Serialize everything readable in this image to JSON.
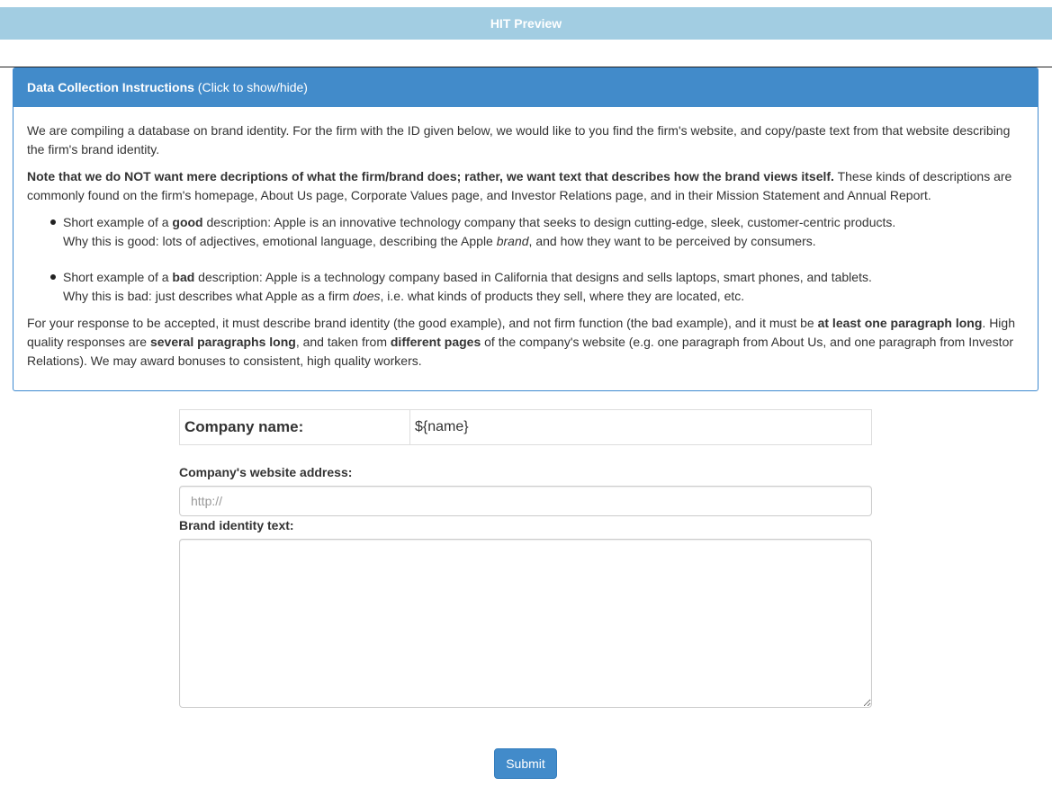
{
  "header": {
    "title": "HIT Preview"
  },
  "instructions": {
    "heading_bold": "Data Collection Instructions",
    "heading_hint": " (Click to show/hide)",
    "intro": "We are compiling a database on brand identity. For the firm with the ID given below, we would like to you find the firm's website, and copy/paste text from that website describing the firm's brand identity.",
    "note_bold": "Note that we do NOT want mere decriptions of what the firm/brand does; rather, we want text that describes how the brand views itself.",
    "note_rest": " These kinds of descriptions are commonly found on the firm's homepage, About Us page, Corporate Values page, and Investor Relations page, and in their Mission Statement and Annual Report.",
    "good_example": {
      "pre": "Short example of a ",
      "bold": "good",
      "post": " description: Apple is an innovative technology company that seeks to design cutting-edge, sleek, customer-centric products.",
      "why_pre": "Why this is good: lots of adjectives, emotional language, describing the Apple ",
      "why_em": "brand",
      "why_post": ", and how they want to be perceived by consumers."
    },
    "bad_example": {
      "pre": "Short example of a ",
      "bold": "bad",
      "post": " description: Apple is a technology company based in California that designs and sells laptops, smart phones, and tablets.",
      "why_pre": "Why this is bad: just describes what Apple as a firm ",
      "why_em": "does",
      "why_post": ", i.e. what kinds of products they sell, where they are located, etc."
    },
    "criteria": {
      "t1": "For your response to be accepted, it must describe brand identity (the good example), and not firm function (the bad example), and it must be ",
      "b1": "at least one paragraph long",
      "t2": ". High quality responses are ",
      "b2": "several paragraphs long",
      "t3": ", and taken from ",
      "b3": "different pages",
      "t4": " of the company's website (e.g. one paragraph from About Us, and one paragraph from Investor Relations). We may award bonuses to consistent, high quality workers."
    }
  },
  "form": {
    "company_name_label": "Company name:",
    "company_name_value": "${name}",
    "website_label": "Company's website address:",
    "website_placeholder": "http://",
    "website_value": "",
    "brand_text_label": "Brand identity text:",
    "brand_text_value": "",
    "submit_label": "Submit"
  },
  "colors": {
    "header_bar": "#a2cde2",
    "panel_heading": "#428bca",
    "submit_button": "#428bca"
  }
}
